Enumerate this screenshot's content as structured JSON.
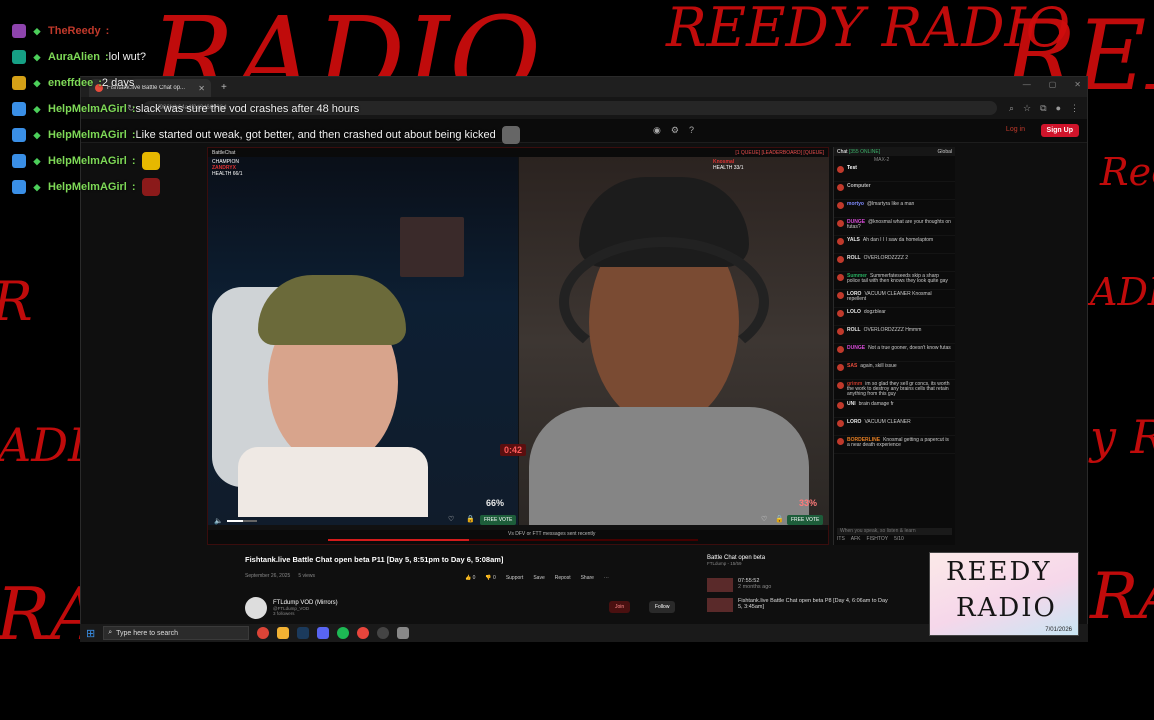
{
  "overlay_chat": [
    {
      "user": "TheReedy",
      "message": "",
      "badge_color": "#8e44ad",
      "name_color": "#c0392b"
    },
    {
      "user": "AuraAlien",
      "message": "lol wut?",
      "badge_color": "#16a085",
      "name_color": "#7ed957"
    },
    {
      "user": "eneffdee",
      "message": "2 days",
      "badge_color": "#d4a017",
      "name_color": "#7ed957"
    },
    {
      "user": "HelpMelmAGirl",
      "message": "slack was sure the vod crashes after 48 hours",
      "badge_color": "#3a8fe6",
      "name_color": "#7ed957"
    },
    {
      "user": "HelpMelmAGirl",
      "message": "Like started out weak, got better, and then crashed out about being kicked",
      "badge_color": "#3a8fe6",
      "name_color": "#7ed957"
    },
    {
      "user": "HelpMelmAGirl",
      "message": "",
      "badge_color": "#3a8fe6",
      "name_color": "#7ed957"
    },
    {
      "user": "HelpMelmAGirl",
      "message": "",
      "badge_color": "#3a8fe6",
      "name_color": "#7ed957"
    }
  ],
  "background": {
    "words": [
      "RADIO",
      "REEDY RADIO",
      "REE",
      "Ree",
      "ADIC",
      "ADIO",
      "RADIO",
      "y RA",
      "RADIC",
      "R"
    ]
  },
  "browser": {
    "tab_title": "Fishtank.live Battle Chat op...",
    "url": "...f986fdb64a4f3d2d66996d",
    "site": {
      "login": "Log in",
      "signup": "Sign Up"
    }
  },
  "player": {
    "left_label": "BattleChat",
    "right_label": "[1 QUEUE] [LEADERBOARD] [QUEUE]",
    "left_hp_title": "CHAMPION",
    "left_hp_name": "ZANDRYX",
    "left_hp_sub": "HEALTH 66/1",
    "right_hp_name": "Knosmal",
    "right_hp_sub": "HEALTH 33/1",
    "left_pct": "66%",
    "right_pct": "33%",
    "timer": "0:42",
    "vote_label": "FREE VOTE",
    "volume_fraction": 0.55,
    "progress_fraction": 0.38,
    "bottom_text": "Vs DFV or FTT messages sent recently"
  },
  "site_chat": {
    "title": "Chat",
    "online": "[355 ONLINE]",
    "scope": "Global",
    "channel": "MAX-2",
    "input_placeholder": "When you speak, so listen & learn",
    "messages": [
      {
        "user": "Test",
        "text": "",
        "color": "#ffffff"
      },
      {
        "user": "Computer",
        "text": "",
        "color": "#bbbbbb"
      },
      {
        "user": "mortyo",
        "text": "@lmartyra like a man",
        "color": "#7f8cff"
      },
      {
        "user": "DUNGE",
        "text": "@knosmal what are your thoughts on futas?",
        "color": "#d84cd8"
      },
      {
        "user": "YALS",
        "text": "Ah dan I I I saw da homelaptom",
        "color": "#e8e8e8"
      },
      {
        "user": "ROLL",
        "text": "OVERLORDZZZZ 2",
        "color": "#e8e8e8"
      },
      {
        "user": "Summer",
        "text": "Summerfateseeds skip a sharp police tail with then knows they look quite gay",
        "color": "#27ae60"
      },
      {
        "user": "LORO",
        "text": "VACUUM CLEANER Knosmal repellent",
        "color": "#e8e8e8"
      },
      {
        "user": "LOLO",
        "text": "dogzblear",
        "color": "#e8e8e8"
      },
      {
        "user": "ROLL",
        "text": "OVERLORDZZZZ Hmmm",
        "color": "#e8e8e8"
      },
      {
        "user": "DUNGE",
        "text": "Not a true gooner, doesn't know futas",
        "color": "#d84cd8"
      },
      {
        "user": "SAS",
        "text": "again, skill issue",
        "color": "#e74c3c"
      },
      {
        "user": "grimm",
        "text": "im so glad they sell gr concs, its worth the work to destroy any brains cells that retain anything from this guy",
        "color": "#c0392b"
      },
      {
        "user": "UNI",
        "text": "brain damage fr",
        "color": "#e8e8e8"
      },
      {
        "user": "LORO",
        "text": "VACUUM CLEANER",
        "color": "#e8e8e8"
      },
      {
        "user": "BORDERLINE",
        "text": "Knosmal getting a papercut is a near death experience",
        "color": "#e67e22"
      }
    ],
    "footer": [
      "ITS",
      "AFK",
      "FISHTOY",
      "5/10"
    ]
  },
  "vod": {
    "title": "Fishtank.live Battle Chat open beta P11 [Day 5, 8:51pm to Day 6, 5:08am]",
    "date": "September 26, 2025",
    "views": "5 views",
    "actions": [
      "0",
      "0",
      "Support",
      "Save",
      "Repost",
      "Share"
    ],
    "channel_name": "FTLdump VOD (Mirrors)",
    "channel_handle": "@FTLdump_VOD",
    "followers": "3 followers",
    "join": "Join",
    "follow": "Follow"
  },
  "playlist": {
    "title": "Battle Chat open beta",
    "sub": "FTLdump - 15/59",
    "items": [
      {
        "time": "07:55:52",
        "text": "2 months ago"
      },
      {
        "time": "",
        "text": "Fishtank.live Battle Chat open beta P8 [Day 4, 6:06am to Day 5, 3:45am]"
      }
    ]
  },
  "taskbar": {
    "search_placeholder": "Type here to search"
  },
  "logo": {
    "line1": "REEDY",
    "line2": "RADIO",
    "date": "7/01/2026"
  },
  "colors": {
    "accent_red": "#d0142b",
    "scribble_red": "#d10d0d"
  }
}
